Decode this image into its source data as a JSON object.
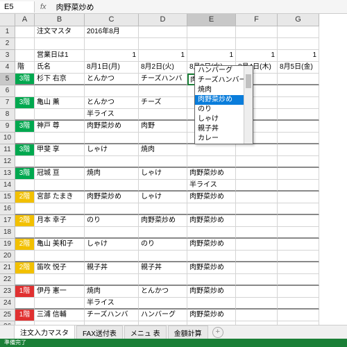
{
  "cellRef": "E5",
  "fxValue": "肉野菜炒め",
  "cols": [
    "",
    "A",
    "B",
    "C",
    "D",
    "E",
    "F",
    "G"
  ],
  "hdr": {
    "b1": "注文マスタ",
    "c1": "2016年8月",
    "b3": "営業日は1",
    "c3": "1",
    "d3": "1",
    "e3": "1",
    "f3": "1",
    "g3": "1",
    "a4": "階",
    "b4": "氏名",
    "c4": "8月1日(月)",
    "d4": "8月2日(火)",
    "e4": "8月3日(水)",
    "f4": "8月4日(木)",
    "g4": "8月5日(金)"
  },
  "rows": [
    {
      "r": 5,
      "fl": "3階",
      "fc": "f3",
      "nm": "杉下 右京",
      "c": "とんかつ",
      "d": "チーズハンバ",
      "e": "肉野菜炒め",
      "thick": true,
      "active": true
    },
    {
      "r": 6,
      "blank": true
    },
    {
      "r": 7,
      "fl": "3階",
      "fc": "f3",
      "nm": "亀山 薫",
      "c": "とんかつ",
      "d": "チーズ"
    },
    {
      "r": 8,
      "c": "半ライス",
      "thick": true
    },
    {
      "r": 9,
      "fl": "3階",
      "fc": "f3",
      "nm": "神戸 尊",
      "c": "肉野菜炒め",
      "d": "肉野"
    },
    {
      "r": 10,
      "thick": true
    },
    {
      "r": 11,
      "fl": "3階",
      "fc": "f3",
      "nm": "甲斐 享",
      "c": "しゃけ",
      "d": "焼肉"
    },
    {
      "r": 12,
      "thick": true
    },
    {
      "r": 13,
      "fl": "3階",
      "fc": "f3",
      "nm": "冠城 亘",
      "c": "焼肉",
      "d": "しゃけ",
      "e": "肉野菜炒め"
    },
    {
      "r": 14,
      "e": "半ライス",
      "thick": true
    },
    {
      "r": 15,
      "fl": "2階",
      "fc": "f2",
      "nm": "宮部 たまき",
      "c": "肉野菜炒め",
      "d": "しゃけ",
      "e": "肉野菜炒め"
    },
    {
      "r": 16,
      "thick": true
    },
    {
      "r": 17,
      "fl": "2階",
      "fc": "f2",
      "nm": "月本 幸子",
      "c": "のり",
      "d": "肉野菜炒め",
      "e": "肉野菜炒め"
    },
    {
      "r": 18,
      "thick": true
    },
    {
      "r": 19,
      "fl": "2階",
      "fc": "f2",
      "nm": "亀山 美和子",
      "c": "しゃけ",
      "d": "のり",
      "e": "肉野菜炒め"
    },
    {
      "r": 20,
      "thick": true
    },
    {
      "r": 21,
      "fl": "2階",
      "fc": "f2",
      "nm": "笛吹 悦子",
      "c": "親子丼",
      "d": "親子丼",
      "e": "肉野菜炒め"
    },
    {
      "r": 22,
      "thick": true
    },
    {
      "r": 23,
      "fl": "1階",
      "fc": "f1",
      "nm": "伊丹 憲一",
      "c": "焼肉",
      "d": "とんかつ",
      "e": "肉野菜炒め"
    },
    {
      "r": 24,
      "c": "半ライス",
      "thick": true
    },
    {
      "r": 25,
      "fl": "1階",
      "fc": "f1",
      "nm": "三浦 信輔",
      "c": "チーズハンバ",
      "d": "ハンバーグ",
      "e": "肉野菜炒め"
    },
    {
      "r": 26
    }
  ],
  "dropdown": [
    "ハンバーグ",
    "チーズハンバーグ",
    "焼肉",
    "肉野菜炒め",
    "のり",
    "しゃけ",
    "親子丼",
    "カレー"
  ],
  "ddHighlight": 3,
  "tabs": [
    "注文入力マスタ",
    "FAX送付表",
    "メニュ 表",
    "金額計算"
  ],
  "activeTab": 0,
  "status": "準備完了"
}
